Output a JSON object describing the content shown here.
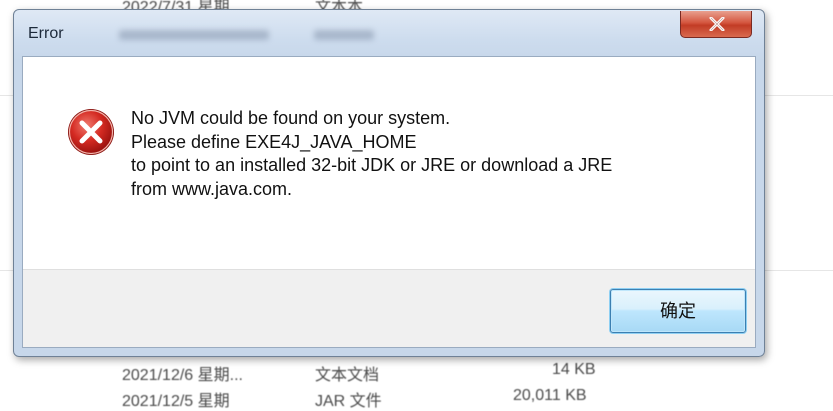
{
  "background_list": {
    "top_row": {
      "date": "2022/7/31 星期",
      "type": "文本本"
    },
    "rows": [
      {
        "date": "2021/12/6 星期...",
        "type": "文本文档",
        "size": "14 KB"
      },
      {
        "date": "2021/12/5 星期",
        "type": "JAR 文件",
        "size": "20,011 KB"
      }
    ]
  },
  "dialog": {
    "title": "Error",
    "message_lines": [
      "No JVM could be found on your system.",
      "Please define EXE4J_JAVA_HOME",
      "to point to an installed 32-bit JDK or JRE or download a JRE",
      "from www.java.com."
    ],
    "ok_label": "确定",
    "icon": "error-icon",
    "close_icon": "close-icon"
  },
  "colors": {
    "error_red": "#c8201e",
    "close_red": "#c23c25",
    "button_blue": "#3c7fb1"
  }
}
